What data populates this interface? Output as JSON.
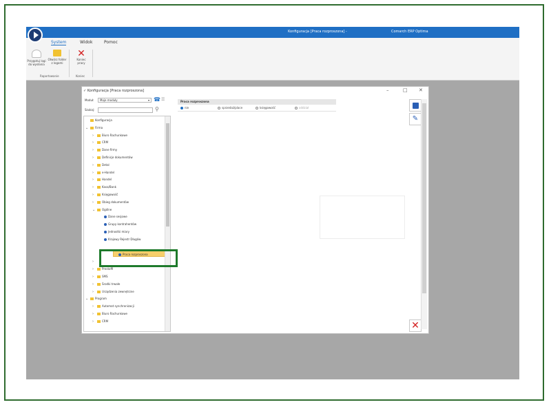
{
  "window": {
    "title": "Konfiguracja [Praca rozproszona] -",
    "app_name": "Comarch ERP Optima"
  },
  "menu": [
    {
      "label": "System",
      "active": true
    },
    {
      "label": "Widok",
      "active": false
    },
    {
      "label": "Pomoc",
      "active": false
    }
  ],
  "ribbon": {
    "buttons": [
      {
        "line1": "Przygotuj logi",
        "line2": "do wysłania",
        "icon": "document-icon"
      },
      {
        "line1": "Otwórz folder",
        "line2": "z logami",
        "icon": "folder-icon"
      },
      {
        "line1": "Koniec",
        "line2": "pracy",
        "icon": "close-icon"
      }
    ],
    "groups": [
      "Raportowanie",
      "Koniec"
    ]
  },
  "dialog": {
    "title": "Konfiguracja [Praca rozproszona]",
    "module_label": "Moduł:",
    "module_value": "Moje moduły",
    "search_label": "Szukaj:",
    "search_value": "",
    "tree": [
      {
        "label": "Konfiguracja",
        "level": 0,
        "type": "folder",
        "expand": ""
      },
      {
        "label": "Firma",
        "level": 0,
        "type": "folder",
        "expand": "v"
      },
      {
        "label": "Biuro Rachunkowe",
        "level": 1,
        "type": "folder",
        "expand": ">"
      },
      {
        "label": "CRM",
        "level": 1,
        "type": "folder",
        "expand": ">"
      },
      {
        "label": "Dane firmy",
        "level": 1,
        "type": "folder",
        "expand": ">"
      },
      {
        "label": "Definicje dokumentów",
        "level": 1,
        "type": "folder",
        "expand": ">"
      },
      {
        "label": "Detal",
        "level": 1,
        "type": "folder",
        "expand": ">"
      },
      {
        "label": "e-Handel",
        "level": 1,
        "type": "folder",
        "expand": ">"
      },
      {
        "label": "Handel",
        "level": 1,
        "type": "folder",
        "expand": ">"
      },
      {
        "label": "Kasa/Bank",
        "level": 1,
        "type": "folder",
        "expand": ">"
      },
      {
        "label": "Księgowość",
        "level": 1,
        "type": "folder",
        "expand": ">"
      },
      {
        "label": "Obieg dokumentów",
        "level": 1,
        "type": "folder",
        "expand": ">"
      },
      {
        "label": "Ogólne",
        "level": 1,
        "type": "folder",
        "expand": "v"
      },
      {
        "label": "Dane sesjowe",
        "level": 2,
        "type": "item",
        "expand": ""
      },
      {
        "label": "Grupy kontrahentów",
        "level": 2,
        "type": "item",
        "expand": ""
      },
      {
        "label": "Jednostki miary",
        "level": 2,
        "type": "item",
        "expand": ""
      },
      {
        "label": "Krajowy Rejestr Długów",
        "level": 2,
        "type": "item",
        "expand": ""
      },
      {
        "label": "",
        "level": 2,
        "type": "spacer",
        "expand": ""
      },
      {
        "label": "Praca rozproszona",
        "level": 2,
        "type": "item",
        "expand": "",
        "selected": true
      },
      {
        "label": "",
        "level": 1,
        "type": "stub",
        "expand": ">"
      },
      {
        "label": "Prestoffi",
        "level": 1,
        "type": "folder",
        "expand": ">"
      },
      {
        "label": "SMS",
        "level": 1,
        "type": "folder",
        "expand": ">"
      },
      {
        "label": "Środki trwałe",
        "level": 1,
        "type": "folder",
        "expand": ">"
      },
      {
        "label": "Urządzenia zewnętrzne",
        "level": 1,
        "type": "folder",
        "expand": ">"
      },
      {
        "label": "Program",
        "level": 0,
        "type": "folder",
        "expand": "v"
      },
      {
        "label": "Automat synchronizacji",
        "level": 1,
        "type": "folder",
        "expand": ">"
      },
      {
        "label": "Biuro Rachunkowe",
        "level": 1,
        "type": "folder",
        "expand": ">"
      },
      {
        "label": "CRM",
        "level": 1,
        "type": "folder",
        "expand": ">"
      }
    ],
    "section_title": "Praca rozproszona",
    "options": [
      {
        "label": "nie",
        "checked": true,
        "disabled": false
      },
      {
        "label": "sprzedaż/place",
        "checked": false,
        "disabled": false
      },
      {
        "label": "księgowość",
        "checked": false,
        "disabled": false
      },
      {
        "label": "oddział",
        "checked": false,
        "disabled": true
      }
    ]
  },
  "colors": {
    "accent": "#1f6fc4",
    "selection": "#f7cf6b",
    "highlight_box": "#1e7a2b",
    "close_red": "#d31f1f"
  }
}
